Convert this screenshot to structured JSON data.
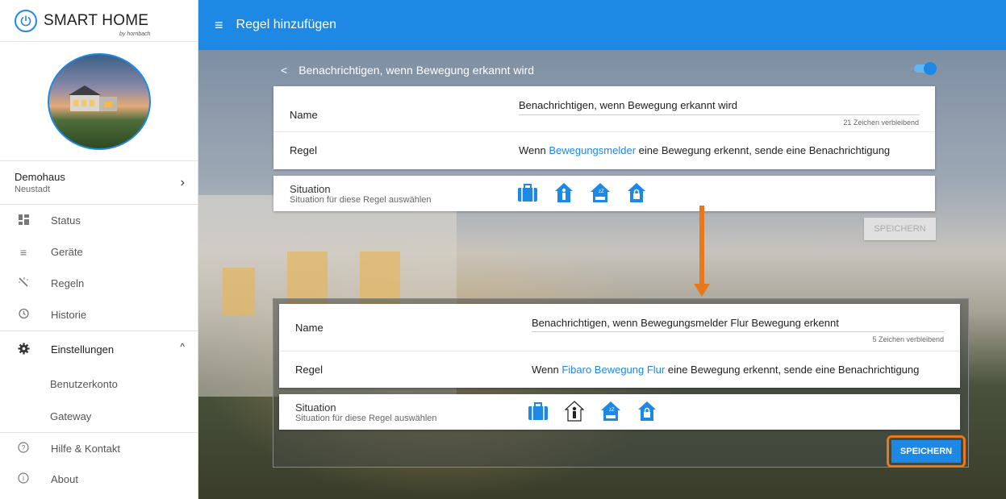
{
  "brand": {
    "name": "SMART HOME",
    "sub": "by hornbach"
  },
  "home": {
    "name": "Demohaus",
    "city": "Neustadt"
  },
  "nav": {
    "status": "Status",
    "geraete": "Geräte",
    "regeln": "Regeln",
    "historie": "Historie",
    "einstellungen": "Einstellungen",
    "benutzerkonto": "Benutzerkonto",
    "gateway": "Gateway",
    "hilfe": "Hilfe & Kontakt",
    "about": "About"
  },
  "topbar": {
    "title": "Regel hinzufügen"
  },
  "rule_header": {
    "back": "<",
    "title": "Benachrichtigen, wenn Bewegung erkannt wird",
    "enabled": true
  },
  "form_top": {
    "name_label": "Name",
    "name_value": "Benachrichtigen, wenn Bewegung erkannt wird",
    "remaining": "21 Zeichen verbleibend",
    "rule_label": "Regel",
    "rule_prefix": "Wenn ",
    "rule_device": "Bewegungsmelder",
    "rule_suffix": " eine Bewegung erkennt, sende eine Benachrichtigung",
    "situation_label": "Situation",
    "situation_hint": "Situation für diese Regel auswählen",
    "save": "SPEICHERN"
  },
  "form_zoom": {
    "name_label": "Name",
    "name_value": "Benachrichtigen, wenn Bewegungsmelder Flur Bewegung erkennt",
    "remaining": "5 Zeichen verbleibend",
    "rule_label": "Regel",
    "rule_prefix": "Wenn ",
    "rule_device": "Fibaro Bewegung Flur",
    "rule_suffix": " eine Bewegung erkennt, sende eine Benachrichtigung",
    "situation_label": "Situation",
    "situation_hint": "Situation für diese Regel auswählen",
    "save": "SPEICHERN"
  },
  "colors": {
    "primary": "#1e88e5",
    "highlight": "#e8781e"
  },
  "icons": [
    "power-icon",
    "dashboard-icon",
    "list-icon",
    "magic-wand-icon",
    "history-icon",
    "gear-icon",
    "help-icon",
    "info-icon",
    "suitcase-icon",
    "person-home-icon",
    "sleep-home-icon",
    "lock-home-icon"
  ]
}
